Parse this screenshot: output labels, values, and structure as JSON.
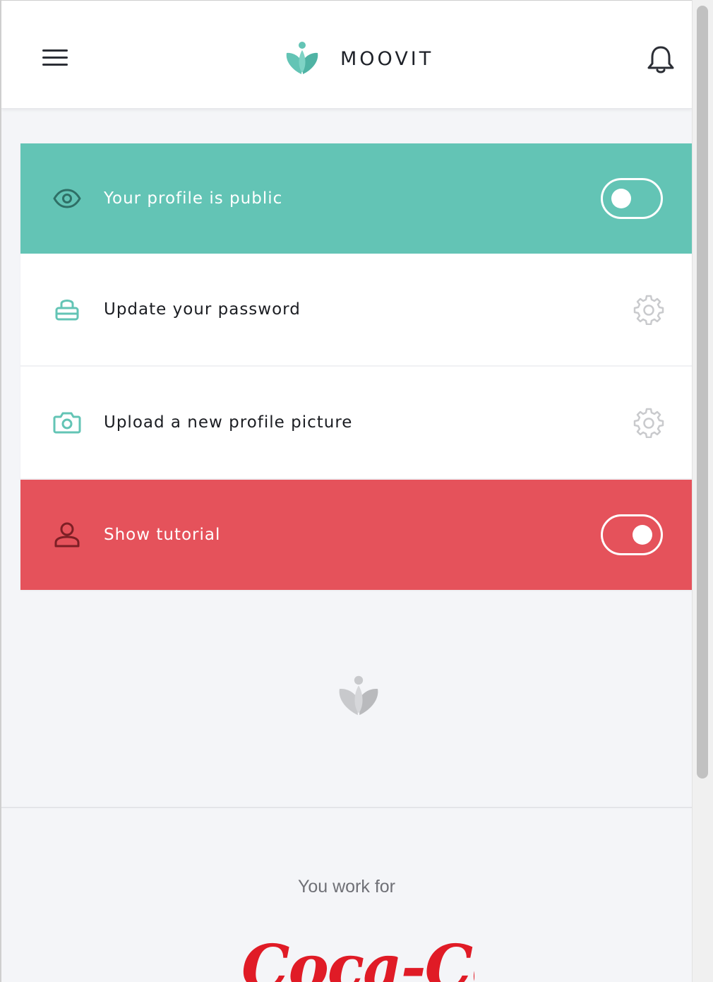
{
  "header": {
    "app_name": "MOOVIT",
    "menu_icon": "hamburger-icon",
    "notification_icon": "bell-icon",
    "brand_color": "#63c4b5"
  },
  "settings": {
    "items": [
      {
        "label": "Your profile is public",
        "icon": "eye-icon",
        "control": "toggle",
        "toggle_on": false,
        "background": "#63c4b5"
      },
      {
        "label": "Update your password",
        "icon": "lock-icon",
        "control": "gear",
        "background": "#ffffff"
      },
      {
        "label": "Upload a new profile picture",
        "icon": "camera-icon",
        "control": "gear",
        "background": "#ffffff"
      },
      {
        "label": "Show tutorial",
        "icon": "user-icon",
        "control": "toggle",
        "toggle_on": true,
        "background": "#e5525b"
      }
    ]
  },
  "footer": {
    "logo_icon": "moovit-logo-icon",
    "work_label": "You work for",
    "company_name": "Coca-Cola",
    "company_color": "#e01b26"
  }
}
